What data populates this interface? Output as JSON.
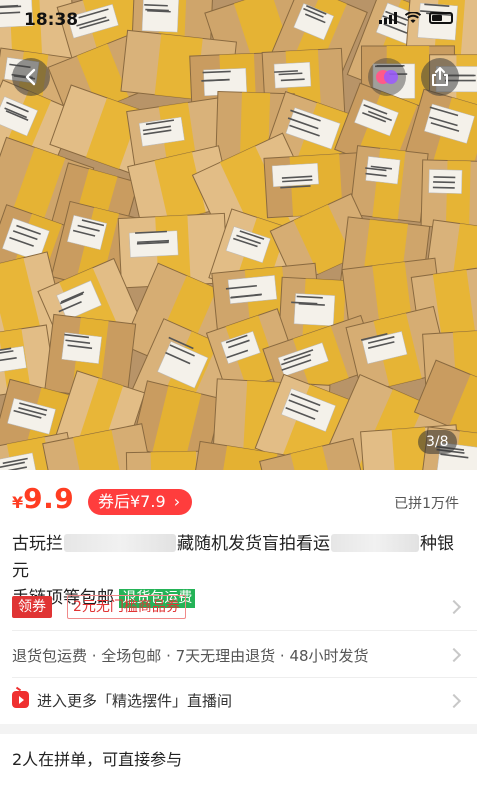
{
  "status_bar": {
    "time": "18:38"
  },
  "gallery": {
    "pager": "3/8"
  },
  "price": {
    "currency": "¥",
    "amount": "9.9",
    "after_coupon": "券后¥7.9",
    "grouped": "已拼1万件",
    "accent": "#ff3d22"
  },
  "title": {
    "part1": "古玩拦",
    "part2": "藏随机发货盲拍看运",
    "part3": "种银元",
    "part4": "手链项等包邮",
    "tag": "退货包运费",
    "tag_color": "#24b357"
  },
  "coupon": {
    "label": "领券",
    "item": "2元无门槛商品券"
  },
  "services": {
    "text": "退货包运费 · 全场包邮 · 7天无理由退货 · 48小时发货"
  },
  "live": {
    "text": "进入更多「精选摆件」直播间"
  },
  "group_buy": {
    "text": "2人在拼单，可直接参与"
  },
  "icons": [
    "back-icon",
    "share-icon",
    "multi-circle-icon",
    "chevron-right-icon",
    "live-tv-icon",
    "wifi-icon",
    "battery-icon",
    "signal-icon"
  ]
}
